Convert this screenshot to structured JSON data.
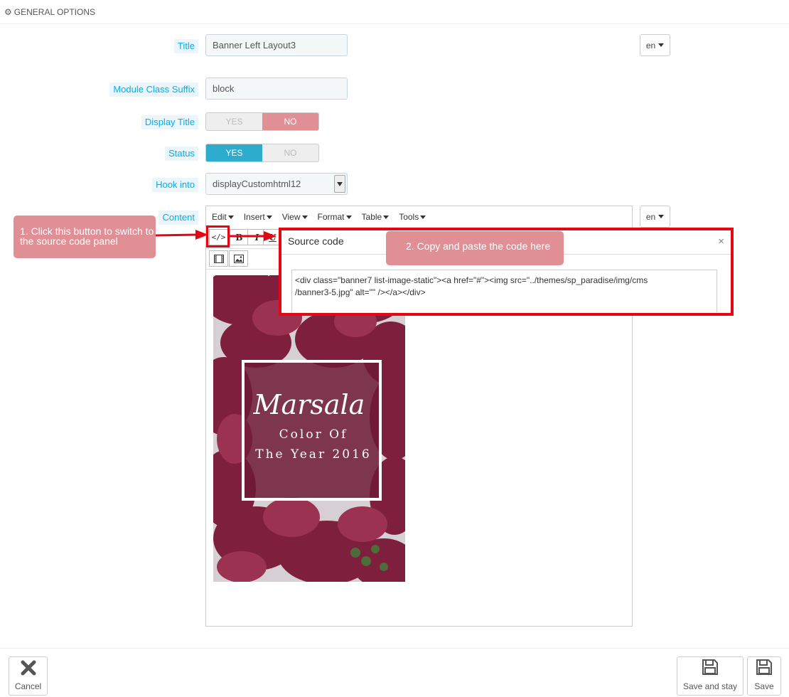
{
  "panel": {
    "heading": "GENERAL OPTIONS",
    "icon": "gears-icon"
  },
  "form": {
    "title_label": "Title",
    "title_value": "Banner Left Layout3",
    "lang": "en",
    "suffix_label": "Module Class Suffix",
    "suffix_value": "block",
    "display_title_label": "Display Title",
    "display_title": {
      "yes": "YES",
      "no": "NO",
      "selected": "NO"
    },
    "status_label": "Status",
    "status": {
      "yes": "YES",
      "no": "NO",
      "selected": "YES"
    },
    "hook_label": "Hook into",
    "hook_value": "displayCustomhtml12",
    "content_label": "Content",
    "content_lang": "en"
  },
  "editor": {
    "menu": [
      "Edit",
      "Insert",
      "View",
      "Format",
      "Table",
      "Tools"
    ],
    "toolbar": {
      "source": "</>",
      "bold": "B",
      "italic": "I",
      "underline": "U"
    }
  },
  "banner": {
    "line1": "Marsala",
    "line2": "Color Of",
    "line3": "The Year 2016"
  },
  "callouts": {
    "step1": "1. Click this button to switch to the source code panel",
    "step2": "2. Copy and paste the code here"
  },
  "dialog": {
    "title": "Source code",
    "close": "×",
    "code": "<div class=\"banner7 list-image-static\"><a href=\"#\"><img src=\"../themes/sp_paradise/img/cms\n/banner3-5.jpg\" alt=\"\" /></a></div>"
  },
  "footer": {
    "cancel": "Cancel",
    "save_stay": "Save and stay",
    "save": "Save"
  },
  "colors": {
    "accent": "#00aff0",
    "yes": "#2eacce",
    "no": "#e08f95",
    "highlight": "#e30613"
  }
}
